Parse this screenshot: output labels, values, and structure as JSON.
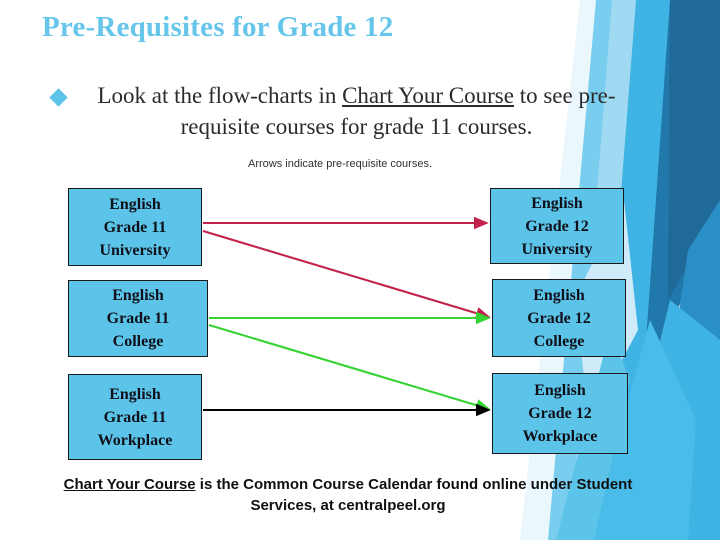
{
  "slide": {
    "title": "Pre-Requisites for Grade 12",
    "title_color": "#66c5ea",
    "background": "#ffffff"
  },
  "bullet": {
    "marker": "diamond-bullet",
    "text_before": "Look at the flow-charts in ",
    "text_link": "Chart Your Course",
    "text_after": " to see pre-requisite courses for grade 11 courses."
  },
  "caption": {
    "text": "Arrows indicate pre-requisite courses."
  },
  "flowchart": {
    "node_fill": "#5cc4e8",
    "node_border": "#1a1a1a",
    "left_column": [
      {
        "line1": "English",
        "line2": "Grade 11",
        "line3": "University"
      },
      {
        "line1": "English",
        "line2": "Grade 11",
        "line3": "College"
      },
      {
        "line1": "English",
        "line2": "Grade 11",
        "line3": "Workplace"
      }
    ],
    "right_column": [
      {
        "line1": "English",
        "line2": "Grade 12",
        "line3": "University"
      },
      {
        "line1": "English",
        "line2": "Grade 12",
        "line3": "College"
      },
      {
        "line1": "English",
        "line2": "Grade 12",
        "line3": "Workplace"
      }
    ],
    "arrows": [
      {
        "name": "grade11-university-to-grade12-university",
        "color": "#c2224b",
        "from": "English Grade 11 University",
        "to": "English Grade 12 University"
      },
      {
        "name": "grade11-university-to-grade12-college",
        "color": "#c2224b",
        "from": "English Grade 11 University",
        "to": "English Grade 12 College"
      },
      {
        "name": "grade11-college-to-grade12-college",
        "color": "#35d435",
        "from": "English Grade 11 College",
        "to": "English Grade 12 College"
      },
      {
        "name": "grade11-college-to-grade12-workplace",
        "color": "#35d435",
        "from": "English Grade 11 College",
        "to": "English Grade 12 Workplace"
      },
      {
        "name": "grade11-workplace-to-grade12-workplace",
        "color": "#000000",
        "from": "English Grade 11 Workplace",
        "to": "English Grade 12 Workplace"
      }
    ]
  },
  "note": {
    "link": "Chart Your Course",
    "rest": " is the Common Course Calendar found online under Student Services, at centralpeel.org"
  },
  "decor": {
    "colors": {
      "pale": "#d7eef9",
      "light": "#9fd9f2",
      "sky": "#79cdee",
      "mid": "#3fb3e4",
      "blue": "#2b8fc7",
      "deep": "#2078ab",
      "navy": "#1f6a99"
    }
  }
}
